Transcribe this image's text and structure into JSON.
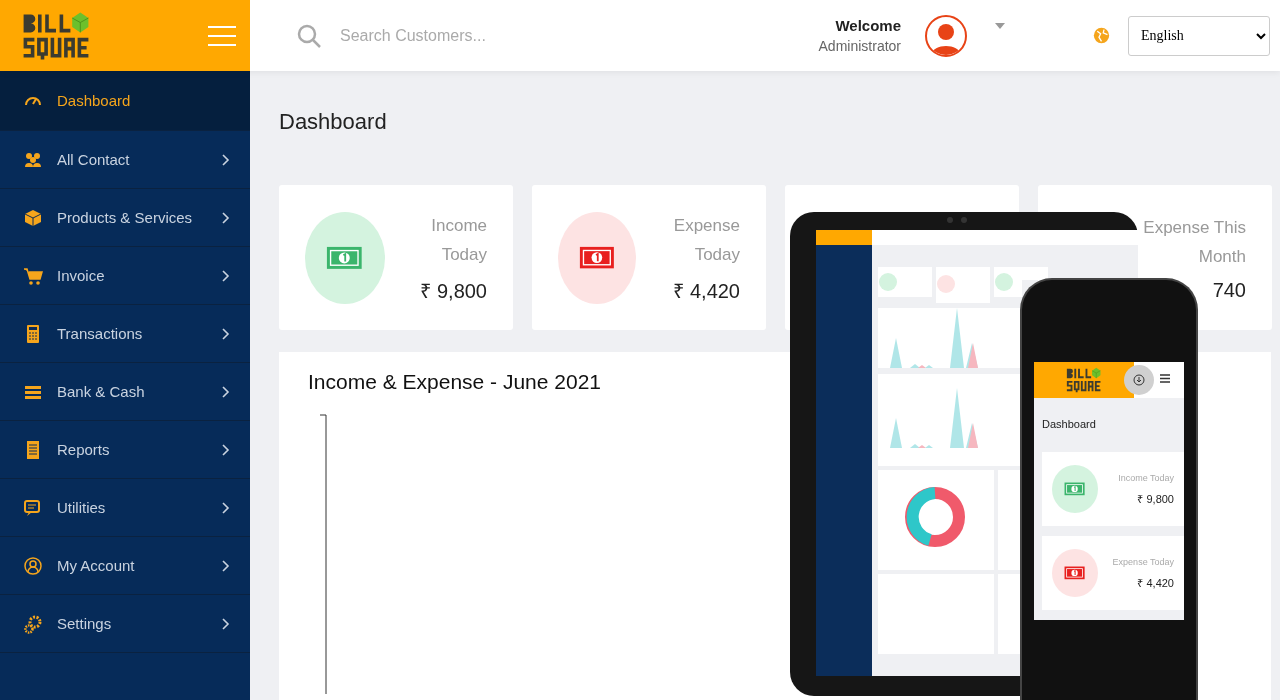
{
  "header": {
    "search": {
      "placeholder": "Search Customers..."
    },
    "user": {
      "greeting": "Welcome",
      "role": "Administrator"
    },
    "language": {
      "value": "English"
    }
  },
  "sidebar": {
    "items": [
      {
        "label": "Dashboard",
        "selected": true
      },
      {
        "label": "All Contact",
        "selected": false
      },
      {
        "label": "Products & Services",
        "selected": false
      },
      {
        "label": "Invoice",
        "selected": false
      },
      {
        "label": "Transactions",
        "selected": false
      },
      {
        "label": "Bank & Cash",
        "selected": false
      },
      {
        "label": "Reports",
        "selected": false
      },
      {
        "label": "Utilities",
        "selected": false
      },
      {
        "label": "My Account",
        "selected": false
      },
      {
        "label": "Settings",
        "selected": false
      }
    ]
  },
  "page": {
    "title": "Dashboard",
    "cards": [
      {
        "kind": "income",
        "label": "Income Today",
        "value": "₹ 9,800"
      },
      {
        "kind": "expense",
        "label": "Expense Today",
        "value": "₹ 4,420"
      },
      {
        "kind": "covered"
      },
      {
        "kind": "expense_partial",
        "label": "Expense This Month",
        "value": "740"
      }
    ],
    "chart": {
      "title": "Income & Expense - June 2021"
    }
  },
  "phone": {
    "title": "Dashboard",
    "cards": [
      {
        "kind": "income",
        "label": "Income Today",
        "value": "₹ 9,800"
      },
      {
        "kind": "expense",
        "label": "Expense Today",
        "value": "₹ 4,420"
      }
    ]
  }
}
